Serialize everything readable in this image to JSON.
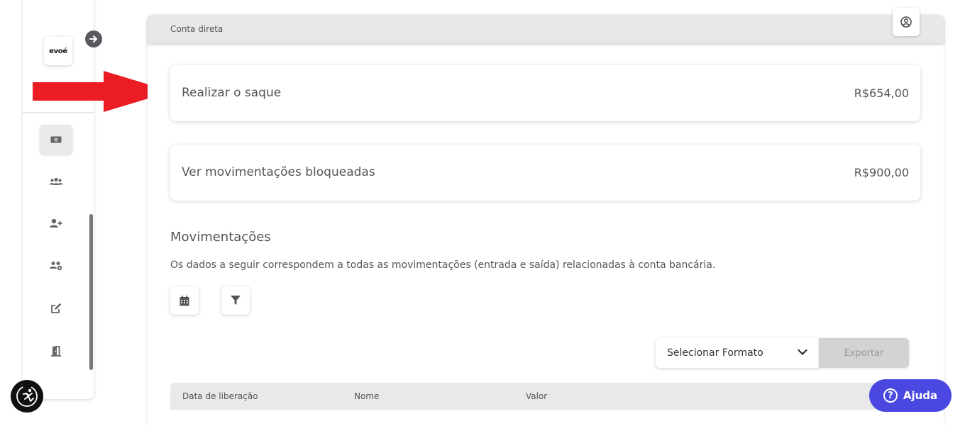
{
  "sidebar": {
    "logo_text": "evoé",
    "items": [
      {
        "icon": "money-icon",
        "active": true
      },
      {
        "icon": "users-icon",
        "active": false
      },
      {
        "icon": "add-user-icon",
        "active": false
      },
      {
        "icon": "group-icon",
        "active": false
      },
      {
        "icon": "edit-icon",
        "active": false
      },
      {
        "icon": "exit-door-icon",
        "active": false
      }
    ]
  },
  "header": {
    "breadcrumb": "Conta direta"
  },
  "cards": {
    "withdraw": {
      "label": "Realizar o saque",
      "value": "R$654,00"
    },
    "blocked": {
      "label": "Ver movimentações bloqueadas",
      "value": "R$900,00"
    }
  },
  "movements": {
    "title": "Movimentações",
    "description": "Os dados a seguir correspondem a todas as movimentações (entrada e saída) relacionadas à conta bancária."
  },
  "export": {
    "select_label": "Selecionar Formato",
    "button_label": "Exportar"
  },
  "table": {
    "columns": [
      "Data de liberação",
      "Nome",
      "Valor"
    ]
  },
  "help": {
    "label": "Ajuda"
  },
  "colors": {
    "accent": "#4a48e0",
    "annotation_arrow": "#ec1c24"
  }
}
